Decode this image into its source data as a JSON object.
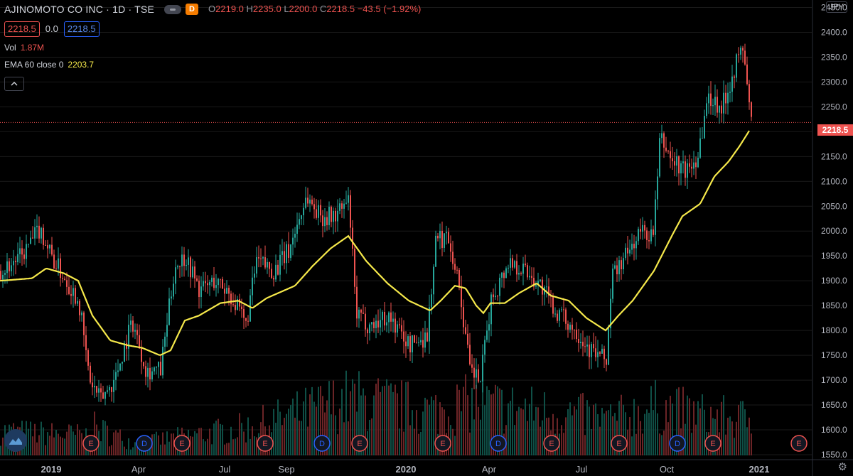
{
  "header": {
    "title": "AJINOMOTO CO INC · 1D · TSE",
    "badge": "D",
    "ohlc": {
      "o_label": "O",
      "o": "2219.0",
      "h_label": "H",
      "h": "2235.0",
      "l_label": "L",
      "l": "2200.0",
      "c_label": "C",
      "c": "2218.5",
      "change": "−43.5 (−1.92%)"
    },
    "bid": "2218.5",
    "spread": "0.0",
    "ask": "2218.5",
    "vol_label": "Vol",
    "vol_value": "1.87M",
    "ema_label": "EMA 60 close 0",
    "ema_value": "2203.7",
    "collapse_icon": "chevron-up"
  },
  "currency": "JPY",
  "last_price": "2218.5",
  "colors": {
    "up": "#26a69a",
    "down": "#ef5350",
    "ema": "#f5e84a",
    "bg": "#000000",
    "grid": "#1a1a1a",
    "text": "#d1d4dc",
    "dividend": "#2962ff",
    "earnings": "#ef5350"
  },
  "chart_data": {
    "type": "candlestick",
    "y_axis_ticks": [
      2450,
      2400,
      2350,
      2300,
      2250,
      2200,
      2150,
      2100,
      2050,
      2000,
      1950,
      1900,
      1850,
      1800,
      1750,
      1700,
      1650,
      1600,
      1550
    ],
    "ylim": [
      1540,
      2465
    ],
    "x_axis_labels": [
      "2019",
      "Apr",
      "Jul",
      "Sep",
      "2020",
      "Apr",
      "Jul",
      "Oct",
      "2021"
    ],
    "ema_anchors": [
      [
        0,
        1900
      ],
      [
        45,
        1905
      ],
      [
        65,
        1925
      ],
      [
        90,
        1915
      ],
      [
        110,
        1900
      ],
      [
        130,
        1830
      ],
      [
        155,
        1780
      ],
      [
        180,
        1770
      ],
      [
        200,
        1765
      ],
      [
        225,
        1750
      ],
      [
        240,
        1760
      ],
      [
        260,
        1820
      ],
      [
        280,
        1830
      ],
      [
        310,
        1855
      ],
      [
        335,
        1860
      ],
      [
        355,
        1845
      ],
      [
        375,
        1865
      ],
      [
        415,
        1890
      ],
      [
        440,
        1930
      ],
      [
        465,
        1965
      ],
      [
        490,
        1990
      ],
      [
        515,
        1940
      ],
      [
        545,
        1895
      ],
      [
        575,
        1860
      ],
      [
        605,
        1840
      ],
      [
        620,
        1860
      ],
      [
        640,
        1890
      ],
      [
        655,
        1885
      ],
      [
        670,
        1850
      ],
      [
        680,
        1835
      ],
      [
        690,
        1855
      ],
      [
        710,
        1855
      ],
      [
        730,
        1875
      ],
      [
        755,
        1895
      ],
      [
        775,
        1870
      ],
      [
        800,
        1860
      ],
      [
        825,
        1825
      ],
      [
        852,
        1800
      ],
      [
        870,
        1830
      ],
      [
        890,
        1860
      ],
      [
        920,
        1920
      ],
      [
        945,
        1990
      ],
      [
        960,
        2030
      ],
      [
        985,
        2055
      ],
      [
        1005,
        2110
      ],
      [
        1025,
        2140
      ],
      [
        1040,
        2170
      ],
      [
        1055,
        2204
      ]
    ],
    "candle_anchors": [
      [
        0,
        1920
      ],
      [
        30,
        1950
      ],
      [
        55,
        2005
      ],
      [
        75,
        1940
      ],
      [
        110,
        1860
      ],
      [
        125,
        1700
      ],
      [
        140,
        1660
      ],
      [
        160,
        1700
      ],
      [
        185,
        1820
      ],
      [
        205,
        1720
      ],
      [
        225,
        1720
      ],
      [
        245,
        1930
      ],
      [
        260,
        1950
      ],
      [
        280,
        1880
      ],
      [
        300,
        1900
      ],
      [
        320,
        1880
      ],
      [
        345,
        1810
      ],
      [
        360,
        1940
      ],
      [
        385,
        1920
      ],
      [
        405,
        1960
      ],
      [
        430,
        2070
      ],
      [
        450,
        2030
      ],
      [
        470,
        2030
      ],
      [
        490,
        2060
      ],
      [
        500,
        1830
      ],
      [
        520,
        1810
      ],
      [
        545,
        1830
      ],
      [
        575,
        1770
      ],
      [
        600,
        1790
      ],
      [
        612,
        1980
      ],
      [
        630,
        1990
      ],
      [
        645,
        1890
      ],
      [
        660,
        1720
      ],
      [
        675,
        1700
      ],
      [
        690,
        1860
      ],
      [
        715,
        1940
      ],
      [
        740,
        1920
      ],
      [
        760,
        1890
      ],
      [
        780,
        1840
      ],
      [
        810,
        1800
      ],
      [
        830,
        1760
      ],
      [
        852,
        1740
      ],
      [
        860,
        1910
      ],
      [
        880,
        1950
      ],
      [
        900,
        2000
      ],
      [
        918,
        1990
      ],
      [
        928,
        2190
      ],
      [
        945,
        2140
      ],
      [
        965,
        2120
      ],
      [
        980,
        2150
      ],
      [
        995,
        2270
      ],
      [
        1015,
        2250
      ],
      [
        1035,
        2340
      ],
      [
        1045,
        2370
      ],
      [
        1055,
        2220
      ]
    ],
    "volume_anchors": [
      [
        0,
        0.3
      ],
      [
        120,
        0.25
      ],
      [
        130,
        0.35
      ],
      [
        190,
        0.15
      ],
      [
        350,
        0.35
      ],
      [
        490,
        0.7
      ],
      [
        610,
        0.55
      ],
      [
        660,
        0.65
      ],
      [
        860,
        0.45
      ],
      [
        920,
        0.6
      ],
      [
        990,
        0.5
      ],
      [
        1040,
        0.45
      ],
      [
        1055,
        0.5
      ]
    ],
    "event_markers": [
      {
        "x_index": 5,
        "type": "E"
      },
      {
        "x_index": 112,
        "type": "E"
      },
      {
        "x_index": 187,
        "type": "D"
      },
      {
        "x_index": 240,
        "type": "E"
      },
      {
        "x_index": 357,
        "type": "E"
      },
      {
        "x_index": 437,
        "type": "D"
      },
      {
        "x_index": 490,
        "type": "E"
      },
      {
        "x_index": 607,
        "type": "E"
      },
      {
        "x_index": 685,
        "type": "D"
      },
      {
        "x_index": 760,
        "type": "E"
      },
      {
        "x_index": 855,
        "type": "E"
      },
      {
        "x_index": 937,
        "type": "D"
      },
      {
        "x_index": 987,
        "type": "E"
      },
      {
        "x_index": 1108,
        "type": "E"
      }
    ]
  }
}
